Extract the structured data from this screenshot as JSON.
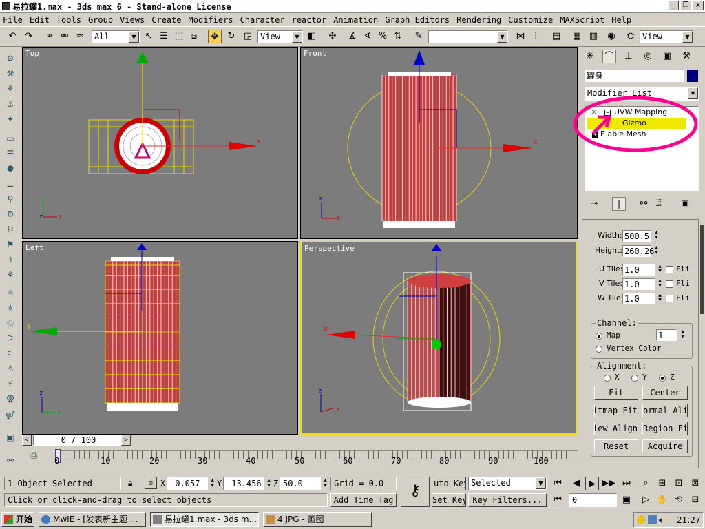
{
  "window": {
    "title": "易拉罐1.max - 3ds max 6 - Stand-alone License",
    "min": "_",
    "max": "❐",
    "close": "×"
  },
  "menu": [
    "File",
    "Edit",
    "Tools",
    "Group",
    "Views",
    "Create",
    "Modifiers",
    "Character",
    "reactor",
    "Animation",
    "Graph Editors",
    "Rendering",
    "Customize",
    "MAXScript",
    "Help"
  ],
  "toolbar": {
    "selection_filter": "All",
    "ref_coord": "View",
    "named_sel": "",
    "view_right": "View"
  },
  "viewports": {
    "top": "Top",
    "front": "Front",
    "left": "Left",
    "perspective": "Perspective"
  },
  "axis": {
    "x": "x",
    "y": "y",
    "z": "z"
  },
  "cmd": {
    "object_name": "罐身",
    "modifier_list": "Modifier List",
    "stack": [
      "UVW Mapping",
      "Gizmo",
      "Editable Mesh"
    ],
    "stack_visible": [
      "UVW Mapping",
      "Gizmo",
      "E      able Mesh"
    ],
    "params": {
      "width_label": "Width:",
      "width_value": "500.5",
      "height_label": "Height:",
      "height_value": "260.26",
      "utile_label": "U Tile:",
      "utile_value": "1.0",
      "vtile_label": "V Tile:",
      "vtile_value": "1.0",
      "wtile_label": "W Tile:",
      "wtile_value": "1.0",
      "flip": "Fli"
    },
    "channel": {
      "title": "Channel:",
      "map": "Map",
      "map_value": "1",
      "vertex": "Vertex Color"
    },
    "alignment": {
      "title": "Alignment:",
      "x": "X",
      "y": "Y",
      "z": "Z",
      "fit": "Fit",
      "center": "Center",
      "bitmap": "Bitmap Fit",
      "normal": "ormal Alig",
      "view": "View Align",
      "region": "Region Fit",
      "reset": "Reset",
      "acquire": "Acquire"
    }
  },
  "timeline": {
    "frame": "0 / 100",
    "ticks": [
      "0",
      "10",
      "20",
      "30",
      "40",
      "50",
      "60",
      "70",
      "80",
      "90",
      "100"
    ]
  },
  "status": {
    "selected": "1 Object Selected",
    "hint": "Click or click-and-drag to select objects",
    "x_label": "X",
    "x": "-0.057",
    "y_label": "Y",
    "y": "-13.456",
    "z_label": "Z",
    "z": "50.0",
    "grid": "Grid = 0.0",
    "add_time_tag": "Add Time Tag",
    "auto_key": "uto Key",
    "set_key": "Set Key",
    "selected_combo": "Selected",
    "key_filters": "Key Filters...",
    "frame_field": "0"
  },
  "taskbar": {
    "start": "开始",
    "tasks": [
      "MwIE - [发表新主题 ...",
      "易拉罐1.max - 3ds m...",
      "4.JPG - 画图"
    ],
    "clock": "21:27"
  },
  "colors": {
    "viewport_bg": "#7c7c7c",
    "wire": "#cc0000",
    "gizmo": "#f0e000",
    "highlight": "#ff0090",
    "active_border": "#f0e000"
  }
}
